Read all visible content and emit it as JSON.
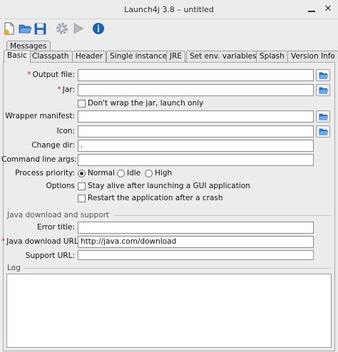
{
  "window": {
    "title": "Launch4j 3.8 – untitled",
    "close_glyph": "✕"
  },
  "toolbar": {
    "buttons": [
      {
        "name": "new-config",
        "icon": "new-file-icon"
      },
      {
        "name": "open-config",
        "icon": "folder-open-icon"
      },
      {
        "name": "save-config",
        "icon": "save-icon"
      },
      {
        "name": "build-wrapper",
        "icon": "gear-icon"
      },
      {
        "name": "test-wrapper",
        "icon": "play-icon"
      },
      {
        "name": "about",
        "icon": "info-icon"
      }
    ]
  },
  "tabs": {
    "row1": [
      "Messages"
    ],
    "row2": [
      "Basic",
      "Classpath",
      "Header",
      "Single instance",
      "JRE",
      "Set env. variables",
      "Splash",
      "Version Info"
    ],
    "active": "Basic"
  },
  "form": {
    "required_mark": "*",
    "output_file": {
      "label": "Output file:",
      "value": ""
    },
    "jar": {
      "label": "Jar:",
      "value": ""
    },
    "dont_wrap": {
      "label": "Don't wrap the jar, launch only",
      "checked": false
    },
    "wrapper_manifest": {
      "label": "Wrapper manifest:",
      "value": ""
    },
    "icon": {
      "label": "Icon:",
      "value": ""
    },
    "change_dir": {
      "label": "Change dir:",
      "value": "."
    },
    "cmd_args": {
      "label": "Command line args:",
      "value": ""
    },
    "priority": {
      "label": "Process priority:",
      "options": [
        "Normal",
        "Idle",
        "High"
      ],
      "selected": "Normal"
    },
    "options": {
      "label": "Options",
      "stay_alive": {
        "label": "Stay alive after launching a GUI application",
        "checked": false
      },
      "restart": {
        "label": "Restart the application after a crash",
        "checked": false
      }
    }
  },
  "java_download": {
    "section_title": "Java download and support",
    "error_title": {
      "label": "Error title:",
      "value": ""
    },
    "download_url": {
      "label": "Java download URL:",
      "value": "http://java.com/download"
    },
    "support_url": {
      "label": "Support URL:",
      "value": ""
    }
  },
  "log": {
    "title": "Log",
    "content": ""
  },
  "colors": {
    "required": "#e0202b",
    "info": "#1565c0",
    "folder": "#2a6fc9"
  }
}
